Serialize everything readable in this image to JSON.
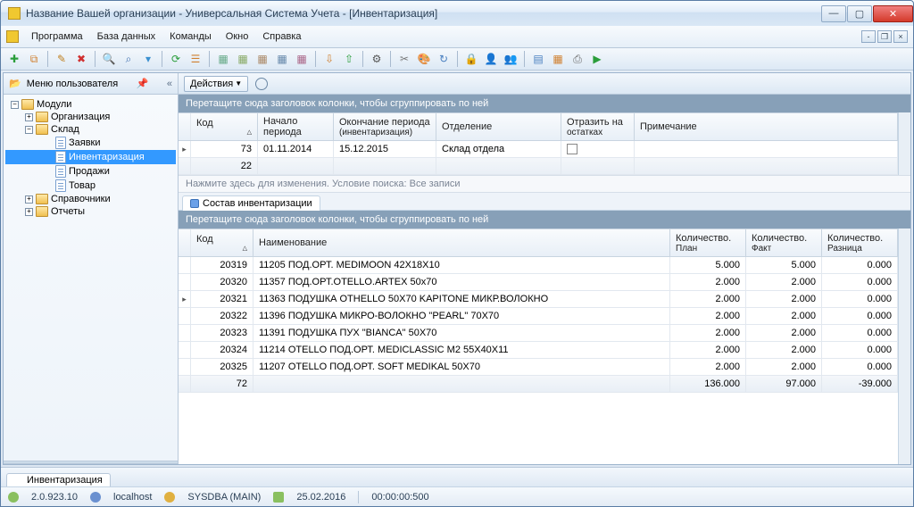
{
  "window": {
    "title": "Название Вашей организации - Универсальная Система Учета - [Инвентаризация]"
  },
  "menubar": {
    "items": [
      "Программа",
      "База данных",
      "Команды",
      "Окно",
      "Справка"
    ]
  },
  "sidebar": {
    "title": "Меню пользователя",
    "nodes": {
      "modules": "Модули",
      "org": "Организация",
      "stock": "Склад",
      "requests": "Заявки",
      "inventory": "Инвентаризация",
      "sales": "Продажи",
      "product": "Товар",
      "refs": "Справочники",
      "reports": "Отчеты"
    }
  },
  "actionbar": {
    "actions": "Действия"
  },
  "groupHint": "Перетащите сюда заголовок колонки, чтобы сгруппировать по ней",
  "topGrid": {
    "cols": {
      "code": "Код",
      "start": "Начало периода",
      "end_top": "Окончание периода",
      "end_sub": "(инвентаризация)",
      "dept": "Отделение",
      "refl_top": "Отразить на",
      "refl_sub": "остатках",
      "note": "Примечание"
    },
    "row": {
      "code": "73",
      "start": "01.11.2014",
      "end": "15.12.2015",
      "dept": "Склад отдела"
    },
    "sum": {
      "code": "22"
    }
  },
  "filter": "Нажмите здесь для изменения. Условие поиска: Все записи",
  "tab": "Состав инвентаризации",
  "bottomGrid": {
    "cols": {
      "code": "Код",
      "name": "Наименование",
      "plan_top": "Количество.",
      "plan_sub": "План",
      "fact_top": "Количество.",
      "fact_sub": "Факт",
      "diff_top": "Количество.",
      "diff_sub": "Разница"
    },
    "rows": [
      {
        "code": "20319",
        "name": "11205 ПОД.ОРТ. MEDIMOON 42X18X10",
        "plan": "5.000",
        "fact": "5.000",
        "diff": "0.000"
      },
      {
        "code": "20320",
        "name": "11357 ПОД.ОРТ.OTELLO.ARTEX 50x70",
        "plan": "2.000",
        "fact": "2.000",
        "diff": "0.000"
      },
      {
        "code": "20321",
        "name": "11363 ПОДУШКА OTHELLO 50X70 KAPITONE МИКР.ВОЛОКНО",
        "plan": "2.000",
        "fact": "2.000",
        "diff": "0.000"
      },
      {
        "code": "20322",
        "name": "11396 ПОДУШКА МИКРО-ВОЛОКНО \"PEARL\" 70X70",
        "plan": "2.000",
        "fact": "2.000",
        "diff": "0.000"
      },
      {
        "code": "20323",
        "name": "11391 ПОДУШКА ПУХ \"BIANCA\" 50X70",
        "plan": "2.000",
        "fact": "2.000",
        "diff": "0.000"
      },
      {
        "code": "20324",
        "name": "11214 OTELLO ПОД.ОРТ. MEDICLASSIC M2 55X40X11",
        "plan": "2.000",
        "fact": "2.000",
        "diff": "0.000"
      },
      {
        "code": "20325",
        "name": "11207 OTELLO ПОД.ОРТ. SOFT MEDIKAL 50X70",
        "plan": "2.000",
        "fact": "2.000",
        "diff": "0.000"
      }
    ],
    "sum": {
      "code": "72",
      "plan": "136.000",
      "fact": "97.000",
      "diff": "-39.000"
    }
  },
  "bottomTab": "Инвентаризация",
  "status": {
    "version": "2.0.923.10",
    "host": "localhost",
    "user": "SYSDBA (MAIN)",
    "date": "25.02.2016",
    "time": "00:00:00:500"
  }
}
